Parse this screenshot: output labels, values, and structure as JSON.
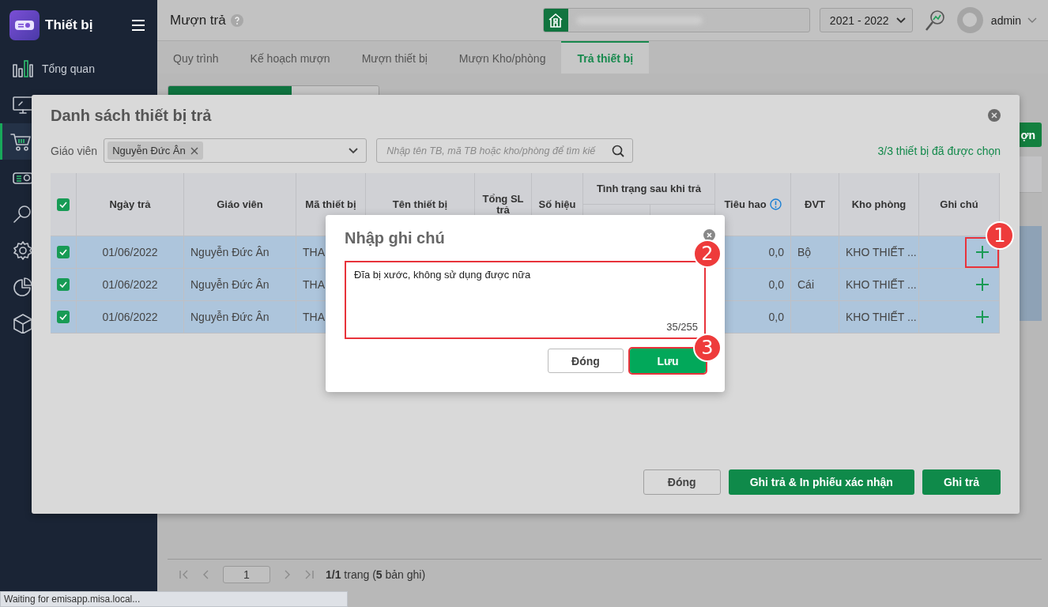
{
  "sidebar": {
    "title": "Thiết bị",
    "items": [
      {
        "label": "Tổng quan",
        "selected": false
      },
      {
        "selected": false
      },
      {
        "selected": true
      },
      {
        "selected": false
      },
      {
        "selected": false
      },
      {
        "selected": false
      },
      {
        "selected": false
      },
      {
        "selected": false
      }
    ]
  },
  "header": {
    "title": "Mượn trả",
    "school_year": "2021 - 2022",
    "user": "admin"
  },
  "tabs": [
    {
      "label": "Quy trình",
      "selected": false
    },
    {
      "label": "Kế hoạch mượn",
      "selected": false
    },
    {
      "label": "Mượn thiết bị",
      "selected": false
    },
    {
      "label": "Mượn Kho/phòng",
      "selected": false
    },
    {
      "label": "Trả thiết bị",
      "selected": true
    }
  ],
  "background": {
    "action_button": "ợn"
  },
  "pagination": {
    "page": "1",
    "summary": "**1/1** trang (**5** bản ghi)"
  },
  "return_dialog": {
    "title": "Danh sách thiết bị trả",
    "teacher_label": "Giáo viên",
    "teacher_chip": "Nguyễn Đức Ân",
    "search_placeholder": "Nhập tên TB, mã TB hoặc kho/phòng để tìm kiế",
    "selected_count": "3/3 thiết bị đã được chọn",
    "all_checked": true,
    "columns": [
      {
        "label": "Ngày trả",
        "kind": "text"
      },
      {
        "label": "Giáo viên",
        "kind": "text"
      },
      {
        "label": "Mã thiết bị",
        "kind": "text"
      },
      {
        "label": "Tên thiết bị",
        "kind": "text"
      },
      {
        "label": "Tổng SL trả",
        "kind": "text"
      },
      {
        "label": "Số hiệu",
        "kind": "text"
      },
      {
        "label": "Tình trạng sau khi trả",
        "kind": "group"
      },
      {
        "label": "Tiêu hao",
        "kind": "info"
      },
      {
        "label": "ĐVT",
        "kind": "text"
      },
      {
        "label": "Kho phòng",
        "kind": "text"
      },
      {
        "label": "Ghi chú",
        "kind": "text"
      }
    ],
    "rows": [
      {
        "checked": true,
        "date": "01/06/2022",
        "teacher": "Nguyễn Đức Ân",
        "code": "THA",
        "consumed": "0,0",
        "unit": "Bộ",
        "room": "KHO THIẾT ...",
        "highlighted": true
      },
      {
        "checked": true,
        "date": "01/06/2022",
        "teacher": "Nguyễn Đức Ân",
        "code": "THA",
        "consumed": "0,0",
        "unit": "Cái",
        "room": "KHO THIẾT ...",
        "highlighted": false
      },
      {
        "checked": true,
        "date": "01/06/2022",
        "teacher": "Nguyễn Đức Ân",
        "code": "THA",
        "consumed": "0,0",
        "room": "KHO THIẾT ...",
        "highlighted": false
      }
    ],
    "buttons": [
      {
        "label": "Đóng",
        "kind": "secondary"
      },
      {
        "label": "Ghi trả & In phiếu xác nhận",
        "kind": "primary"
      },
      {
        "label": "Ghi trả",
        "kind": "primary"
      }
    ]
  },
  "note_dialog": {
    "title": "Nhập ghi chú",
    "value": "Đĩa bị xước, không sử dụng được nữa",
    "counter": "35/255",
    "highlighted": true,
    "buttons": [
      {
        "label": "Đóng",
        "kind": "secondary",
        "highlighted": false
      },
      {
        "label": "Lưu",
        "kind": "primary",
        "highlighted": true
      }
    ]
  },
  "step_markers": [
    "1",
    "2",
    "3"
  ],
  "status_bar": "Waiting for emisapp.misa.local..."
}
